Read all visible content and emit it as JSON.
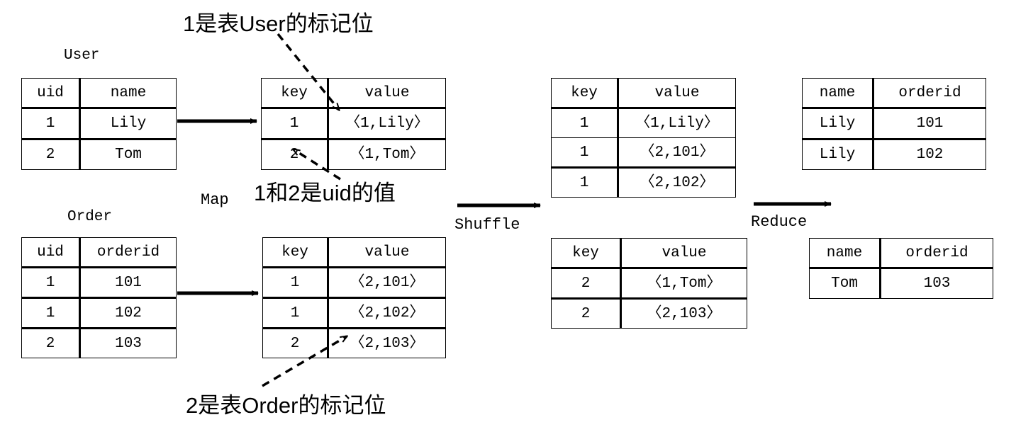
{
  "diagram": {
    "title_hint": "MapReduce Reduce-side Join",
    "stage_labels": {
      "map": "Map",
      "shuffle": "Shuffle",
      "reduce": "Reduce"
    },
    "notes": [
      {
        "id": "note-user-flag",
        "text": "1是表User的标记位"
      },
      {
        "id": "note-uid-values",
        "text": "1和2是uid的值"
      },
      {
        "id": "note-order-flag",
        "text": "2是表Order的标记位"
      }
    ]
  },
  "tables": {
    "user_input": {
      "caption": "User",
      "headers": [
        "uid",
        "name"
      ],
      "rows": [
        [
          "1",
          "Lily"
        ],
        [
          "2",
          "Tom"
        ]
      ]
    },
    "order_input": {
      "caption": "Order",
      "headers": [
        "uid",
        "orderid"
      ],
      "rows": [
        [
          "1",
          "101"
        ],
        [
          "1",
          "102"
        ],
        [
          "2",
          "103"
        ]
      ]
    },
    "map_user_out": {
      "headers": [
        "key",
        "value"
      ],
      "rows": [
        [
          "1",
          "〈1,Lily〉"
        ],
        [
          "2",
          "〈1,Tom〉"
        ]
      ]
    },
    "map_order_out": {
      "headers": [
        "key",
        "value"
      ],
      "rows": [
        [
          "1",
          "〈2,101〉"
        ],
        [
          "1",
          "〈2,102〉"
        ],
        [
          "2",
          "〈2,103〉"
        ]
      ]
    },
    "shuffle_key1": {
      "headers": [
        "key",
        "value"
      ],
      "rows": [
        [
          "1",
          "〈1,Lily〉"
        ],
        [
          "1",
          "〈2,101〉"
        ],
        [
          "1",
          "〈2,102〉"
        ]
      ]
    },
    "shuffle_key2": {
      "headers": [
        "key",
        "value"
      ],
      "rows": [
        [
          "2",
          "〈1,Tom〉"
        ],
        [
          "2",
          "〈2,103〉"
        ]
      ]
    },
    "reduce_out1": {
      "headers": [
        "name",
        "orderid"
      ],
      "rows": [
        [
          "Lily",
          "101"
        ],
        [
          "Lily",
          "102"
        ]
      ]
    },
    "reduce_out2": {
      "headers": [
        "name",
        "orderid"
      ],
      "rows": [
        [
          "Tom",
          "103"
        ]
      ]
    }
  },
  "colors": {
    "ink": "#000000",
    "background": "#ffffff"
  }
}
